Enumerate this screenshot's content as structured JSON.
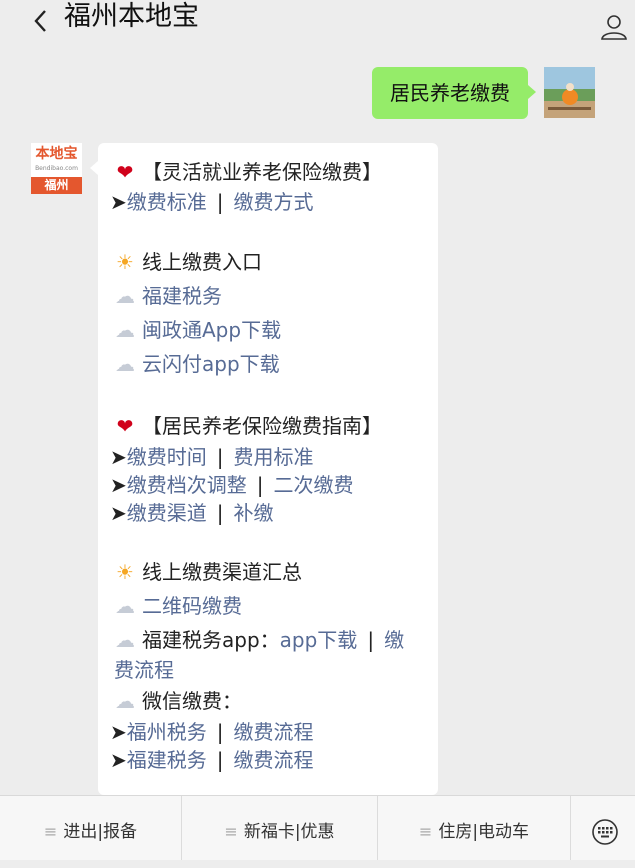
{
  "header": {
    "title": "福州本地宝"
  },
  "outgoing_message": "居民养老缴费",
  "avatar_logo": {
    "top": "本地宝",
    "mid": "Bendibao.com",
    "city": "福州"
  },
  "message": {
    "section1": {
      "title": "【灵活就业养老保险缴费】",
      "link1": "缴费标准",
      "link2": "缴费方式"
    },
    "online": {
      "title": "线上缴费入口",
      "items": [
        "福建税务",
        "闽政通App下载",
        "云闪付app下载"
      ]
    },
    "section2": {
      "title": "【居民养老保险缴费指南】",
      "row1": [
        "缴费时间",
        "费用标准"
      ],
      "row2": [
        "缴费档次调整",
        "二次缴费"
      ],
      "row3": [
        "缴费渠道",
        "补缴"
      ]
    },
    "channels": {
      "title": "线上缴费渠道汇总",
      "qrcode": "二维码缴费",
      "app_prefix": "福建税务app：",
      "app_link1": "app下载",
      "app_link2a": "缴",
      "app_link2b": "费流程",
      "wechat": "微信缴费：",
      "row1": [
        "福州税务",
        "缴费流程"
      ],
      "row2": [
        "福建税务",
        "缴费流程"
      ]
    },
    "arrow": "➤",
    "separator": "|"
  },
  "bottom_menu": {
    "item1": "进出|报备",
    "item2": "新福卡|优惠",
    "item3": "住房|电动车"
  },
  "colors": {
    "background": "#ededed",
    "outgoing_bubble": "#95ec69",
    "link": "#576b95",
    "brand": "#e4572e"
  }
}
